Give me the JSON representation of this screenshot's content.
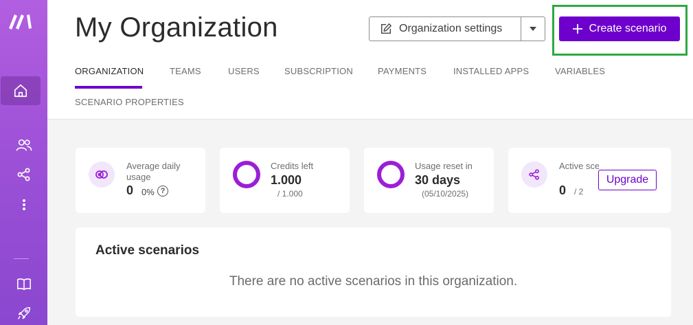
{
  "page": {
    "title": "My Organization"
  },
  "header": {
    "org_settings_label": "Organization settings",
    "create_label": "Create scenario"
  },
  "tabs": [
    {
      "label": "ORGANIZATION",
      "active": true
    },
    {
      "label": "TEAMS"
    },
    {
      "label": "USERS"
    },
    {
      "label": "SUBSCRIPTION"
    },
    {
      "label": "PAYMENTS"
    },
    {
      "label": "INSTALLED APPS"
    },
    {
      "label": "VARIABLES"
    },
    {
      "label": "SCENARIO PROPERTIES"
    }
  ],
  "stats": {
    "daily": {
      "label": "Average daily usage",
      "value": "0",
      "percent": "0%",
      "icon": "help-icon"
    },
    "credits": {
      "label": "Credits left",
      "value": "1.000",
      "sub": "/ 1.000"
    },
    "reset": {
      "label": "Usage reset in",
      "value": "30 days",
      "sub": "(05/10/2025)"
    },
    "active": {
      "label": "Active scenarios",
      "value": "0",
      "sub": "/ 2",
      "upgrade_label": "Upgrade"
    }
  },
  "panel": {
    "title": "Active scenarios",
    "empty_text": "There are no active scenarios in this organization."
  },
  "sidebar": {
    "icons": [
      "make-logo-icon",
      "home-icon",
      "users-icon",
      "share-icon",
      "more-icon",
      "book-icon",
      "rocket-icon"
    ]
  },
  "colors": {
    "accent": "#6d00cc",
    "ring": "#9b1fd6",
    "highlight": "#2da843",
    "sidebar": "#9a4fd6"
  }
}
